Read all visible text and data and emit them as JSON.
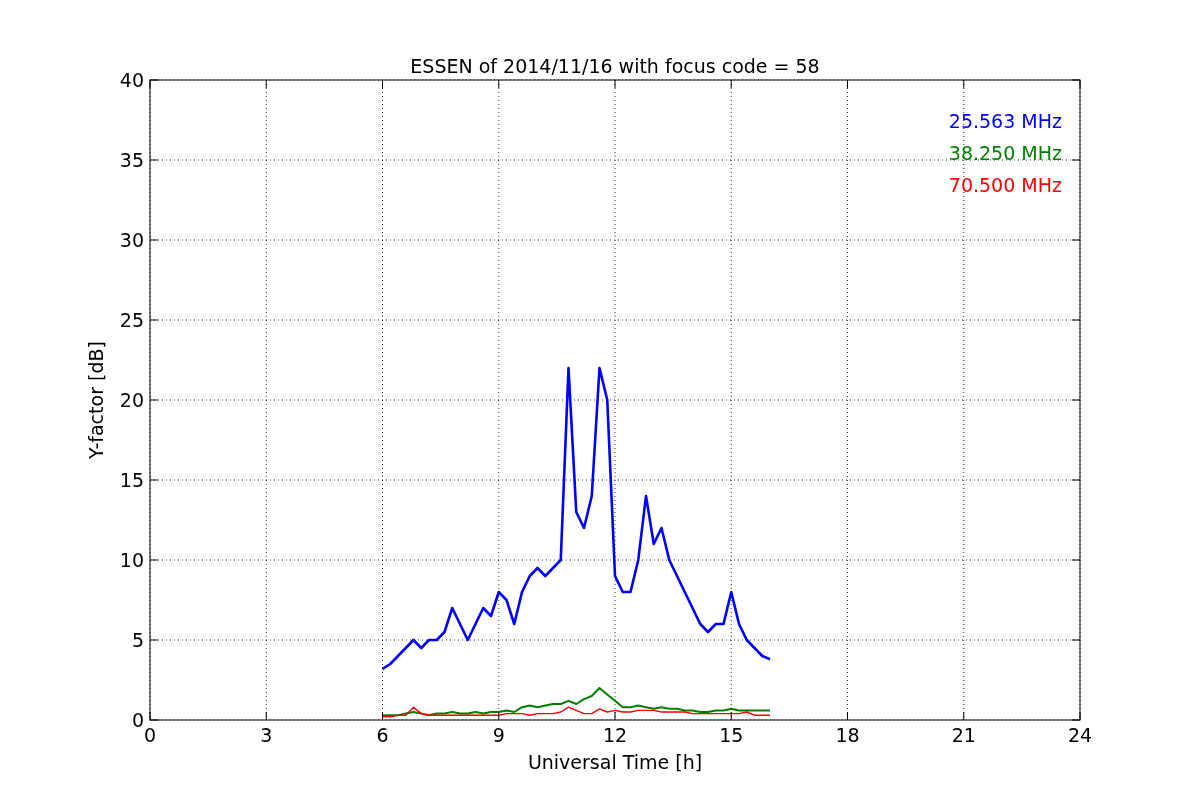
{
  "chart": {
    "chart_data": {
      "type": "line",
      "title": "ESSEN of 2014/11/16 with focus code = 58",
      "xlabel": "Universal Time [h]",
      "ylabel": "Y-factor [dB]",
      "x": [
        6.0,
        6.2,
        6.4,
        6.6,
        6.8,
        7.0,
        7.2,
        7.4,
        7.6,
        7.8,
        8.0,
        8.2,
        8.4,
        8.6,
        8.8,
        9.0,
        9.2,
        9.4,
        9.6,
        9.8,
        10.0,
        10.2,
        10.4,
        10.6,
        10.8,
        11.0,
        11.2,
        11.4,
        11.6,
        11.8,
        12.0,
        12.2,
        12.4,
        12.6,
        12.8,
        13.0,
        13.2,
        13.4,
        13.6,
        13.8,
        14.0,
        14.2,
        14.4,
        14.6,
        14.8,
        15.0,
        15.2,
        15.4,
        15.6,
        15.8,
        16.0
      ],
      "series": [
        {
          "name": "25.563 MHz",
          "color": "#0000ff",
          "values": [
            3.2,
            3.5,
            4.0,
            4.5,
            5.0,
            4.5,
            5.0,
            5.0,
            5.5,
            7.0,
            6.0,
            5.0,
            6.0,
            7.0,
            6.5,
            8.0,
            7.5,
            6.0,
            8.0,
            9.0,
            9.5,
            9.0,
            9.5,
            10.0,
            22.0,
            13.0,
            12.0,
            14.0,
            22.0,
            20.0,
            9.0,
            8.0,
            8.0,
            10.0,
            14.0,
            11.0,
            12.0,
            10.0,
            9.0,
            8.0,
            7.0,
            6.0,
            5.5,
            6.0,
            6.0,
            8.0,
            6.0,
            5.0,
            4.5,
            4.0,
            3.8
          ]
        },
        {
          "name": "38.250 MHz",
          "color": "#008000",
          "values": [
            0.3,
            0.3,
            0.3,
            0.4,
            0.5,
            0.4,
            0.3,
            0.4,
            0.4,
            0.5,
            0.4,
            0.4,
            0.5,
            0.4,
            0.5,
            0.5,
            0.6,
            0.5,
            0.8,
            0.9,
            0.8,
            0.9,
            1.0,
            1.0,
            1.2,
            1.0,
            1.3,
            1.5,
            2.0,
            1.6,
            1.2,
            0.8,
            0.8,
            0.9,
            0.8,
            0.7,
            0.8,
            0.7,
            0.7,
            0.6,
            0.6,
            0.5,
            0.5,
            0.6,
            0.6,
            0.7,
            0.6,
            0.6,
            0.6,
            0.6,
            0.6
          ]
        },
        {
          "name": "70.500 MHz",
          "color": "#ff0000",
          "values": [
            0.2,
            0.2,
            0.3,
            0.3,
            0.8,
            0.4,
            0.3,
            0.3,
            0.3,
            0.3,
            0.3,
            0.3,
            0.3,
            0.3,
            0.3,
            0.3,
            0.4,
            0.4,
            0.4,
            0.3,
            0.4,
            0.4,
            0.4,
            0.5,
            0.8,
            0.6,
            0.4,
            0.4,
            0.7,
            0.5,
            0.6,
            0.5,
            0.5,
            0.6,
            0.6,
            0.6,
            0.5,
            0.5,
            0.5,
            0.5,
            0.4,
            0.4,
            0.4,
            0.4,
            0.4,
            0.4,
            0.4,
            0.5,
            0.3,
            0.3,
            0.3
          ]
        }
      ],
      "xlim": [
        0,
        24
      ],
      "ylim": [
        0,
        40
      ],
      "xticks": [
        0,
        3,
        6,
        9,
        12,
        15,
        18,
        21,
        24
      ],
      "yticks": [
        0,
        5,
        10,
        15,
        20,
        25,
        30,
        35,
        40
      ],
      "grid": true
    }
  }
}
